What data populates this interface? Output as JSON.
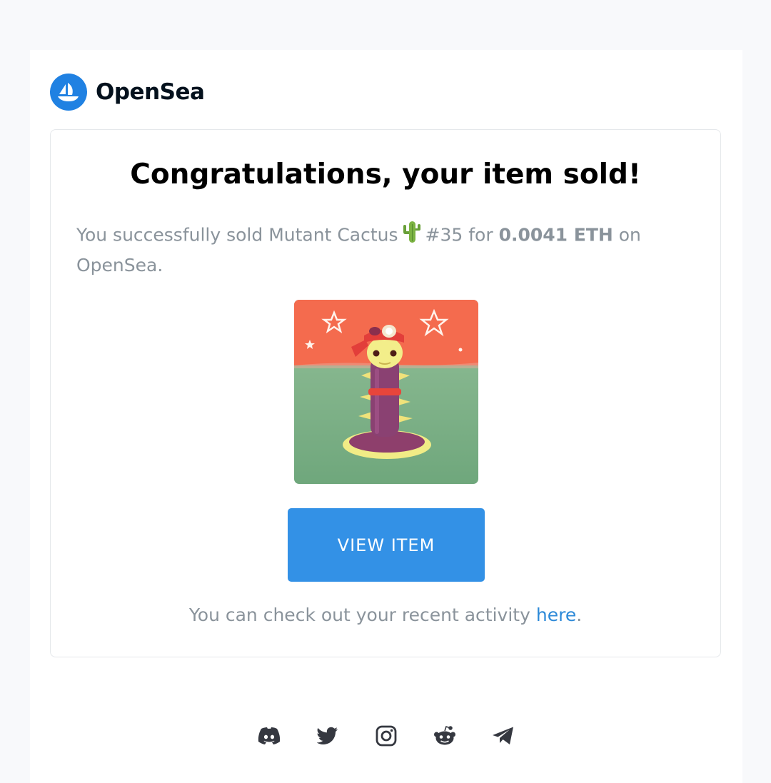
{
  "brand": {
    "name": "OpenSea"
  },
  "card": {
    "headline": "Congratulations, your item sold!",
    "message": {
      "prefix": "You successfully sold Mutant Cactus",
      "item_number": "#35 for",
      "price": "0.0041 ETH",
      "suffix": "on OpenSea."
    },
    "image_alt": "Mutant Cactus #35",
    "button_label": "VIEW ITEM",
    "activity": {
      "text": "You can check out your recent activity",
      "link_label": "here",
      "end": "."
    }
  },
  "footer": {
    "social_icons": [
      "discord-icon",
      "twitter-icon",
      "instagram-icon",
      "reddit-icon",
      "telegram-icon"
    ]
  },
  "colors": {
    "page_background": "#f8f9fb",
    "brand_blue": "#2081e2",
    "button_blue": "#3391e6",
    "link_blue": "#2e8ad8",
    "muted_text": "#8a939b",
    "icon_dark": "#353840"
  }
}
